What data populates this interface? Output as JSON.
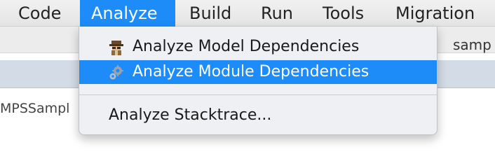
{
  "menubar": {
    "items": [
      {
        "label": "Code"
      },
      {
        "label": "Analyze"
      },
      {
        "label": "Build"
      },
      {
        "label": "Run"
      },
      {
        "label": "Tools"
      },
      {
        "label": "Migration"
      }
    ]
  },
  "background": {
    "tab_fragment": "samp",
    "tree_label": "MPSSampl"
  },
  "dropdown": {
    "items": [
      {
        "label": "Analyze Model Dependencies",
        "icon": "spy-icon"
      },
      {
        "label": "Analyze Module Dependencies",
        "icon": "gears-icon"
      },
      {
        "label": "Analyze Stacktrace..."
      }
    ]
  },
  "colors": {
    "highlight": "#1d8cf8",
    "menu_background": "#eef0f3"
  }
}
